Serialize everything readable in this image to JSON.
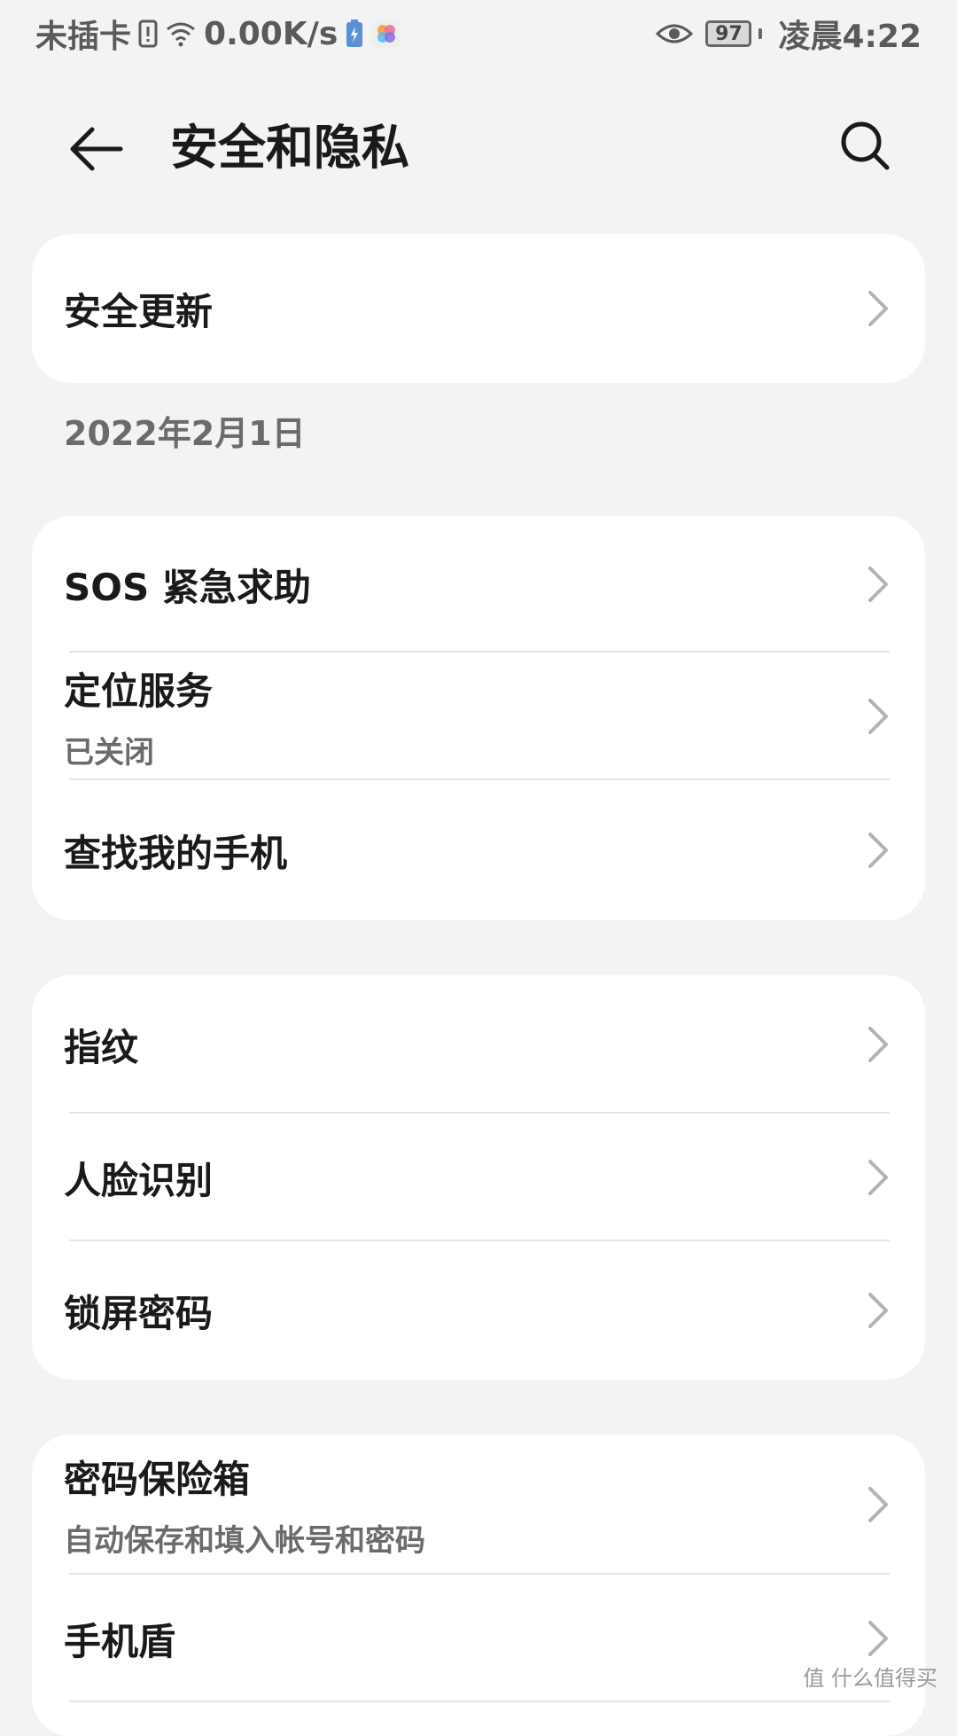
{
  "status_bar": {
    "carrier": "未插卡",
    "net_speed": "0.00K/s",
    "battery": "97",
    "time": "凌晨4:22"
  },
  "header": {
    "title": "安全和隐私"
  },
  "security_update": {
    "label": "安全更新",
    "date": "2022年2月1日"
  },
  "group1": [
    {
      "label": "SOS 紧急求助"
    },
    {
      "label": "定位服务",
      "sub": "已关闭"
    },
    {
      "label": "查找我的手机"
    }
  ],
  "group2": [
    {
      "label": "指纹"
    },
    {
      "label": "人脸识别"
    },
    {
      "label": "锁屏密码"
    }
  ],
  "group3": [
    {
      "label": "密码保险箱",
      "sub": "自动保存和填入帐号和密码"
    },
    {
      "label": "手机盾"
    }
  ],
  "watermark": "值 什么值得买",
  "colors": {
    "background": "#f1f3f5",
    "card": "#ffffff",
    "text": "#1a1a1a",
    "secondary": "#6b6b6b"
  }
}
